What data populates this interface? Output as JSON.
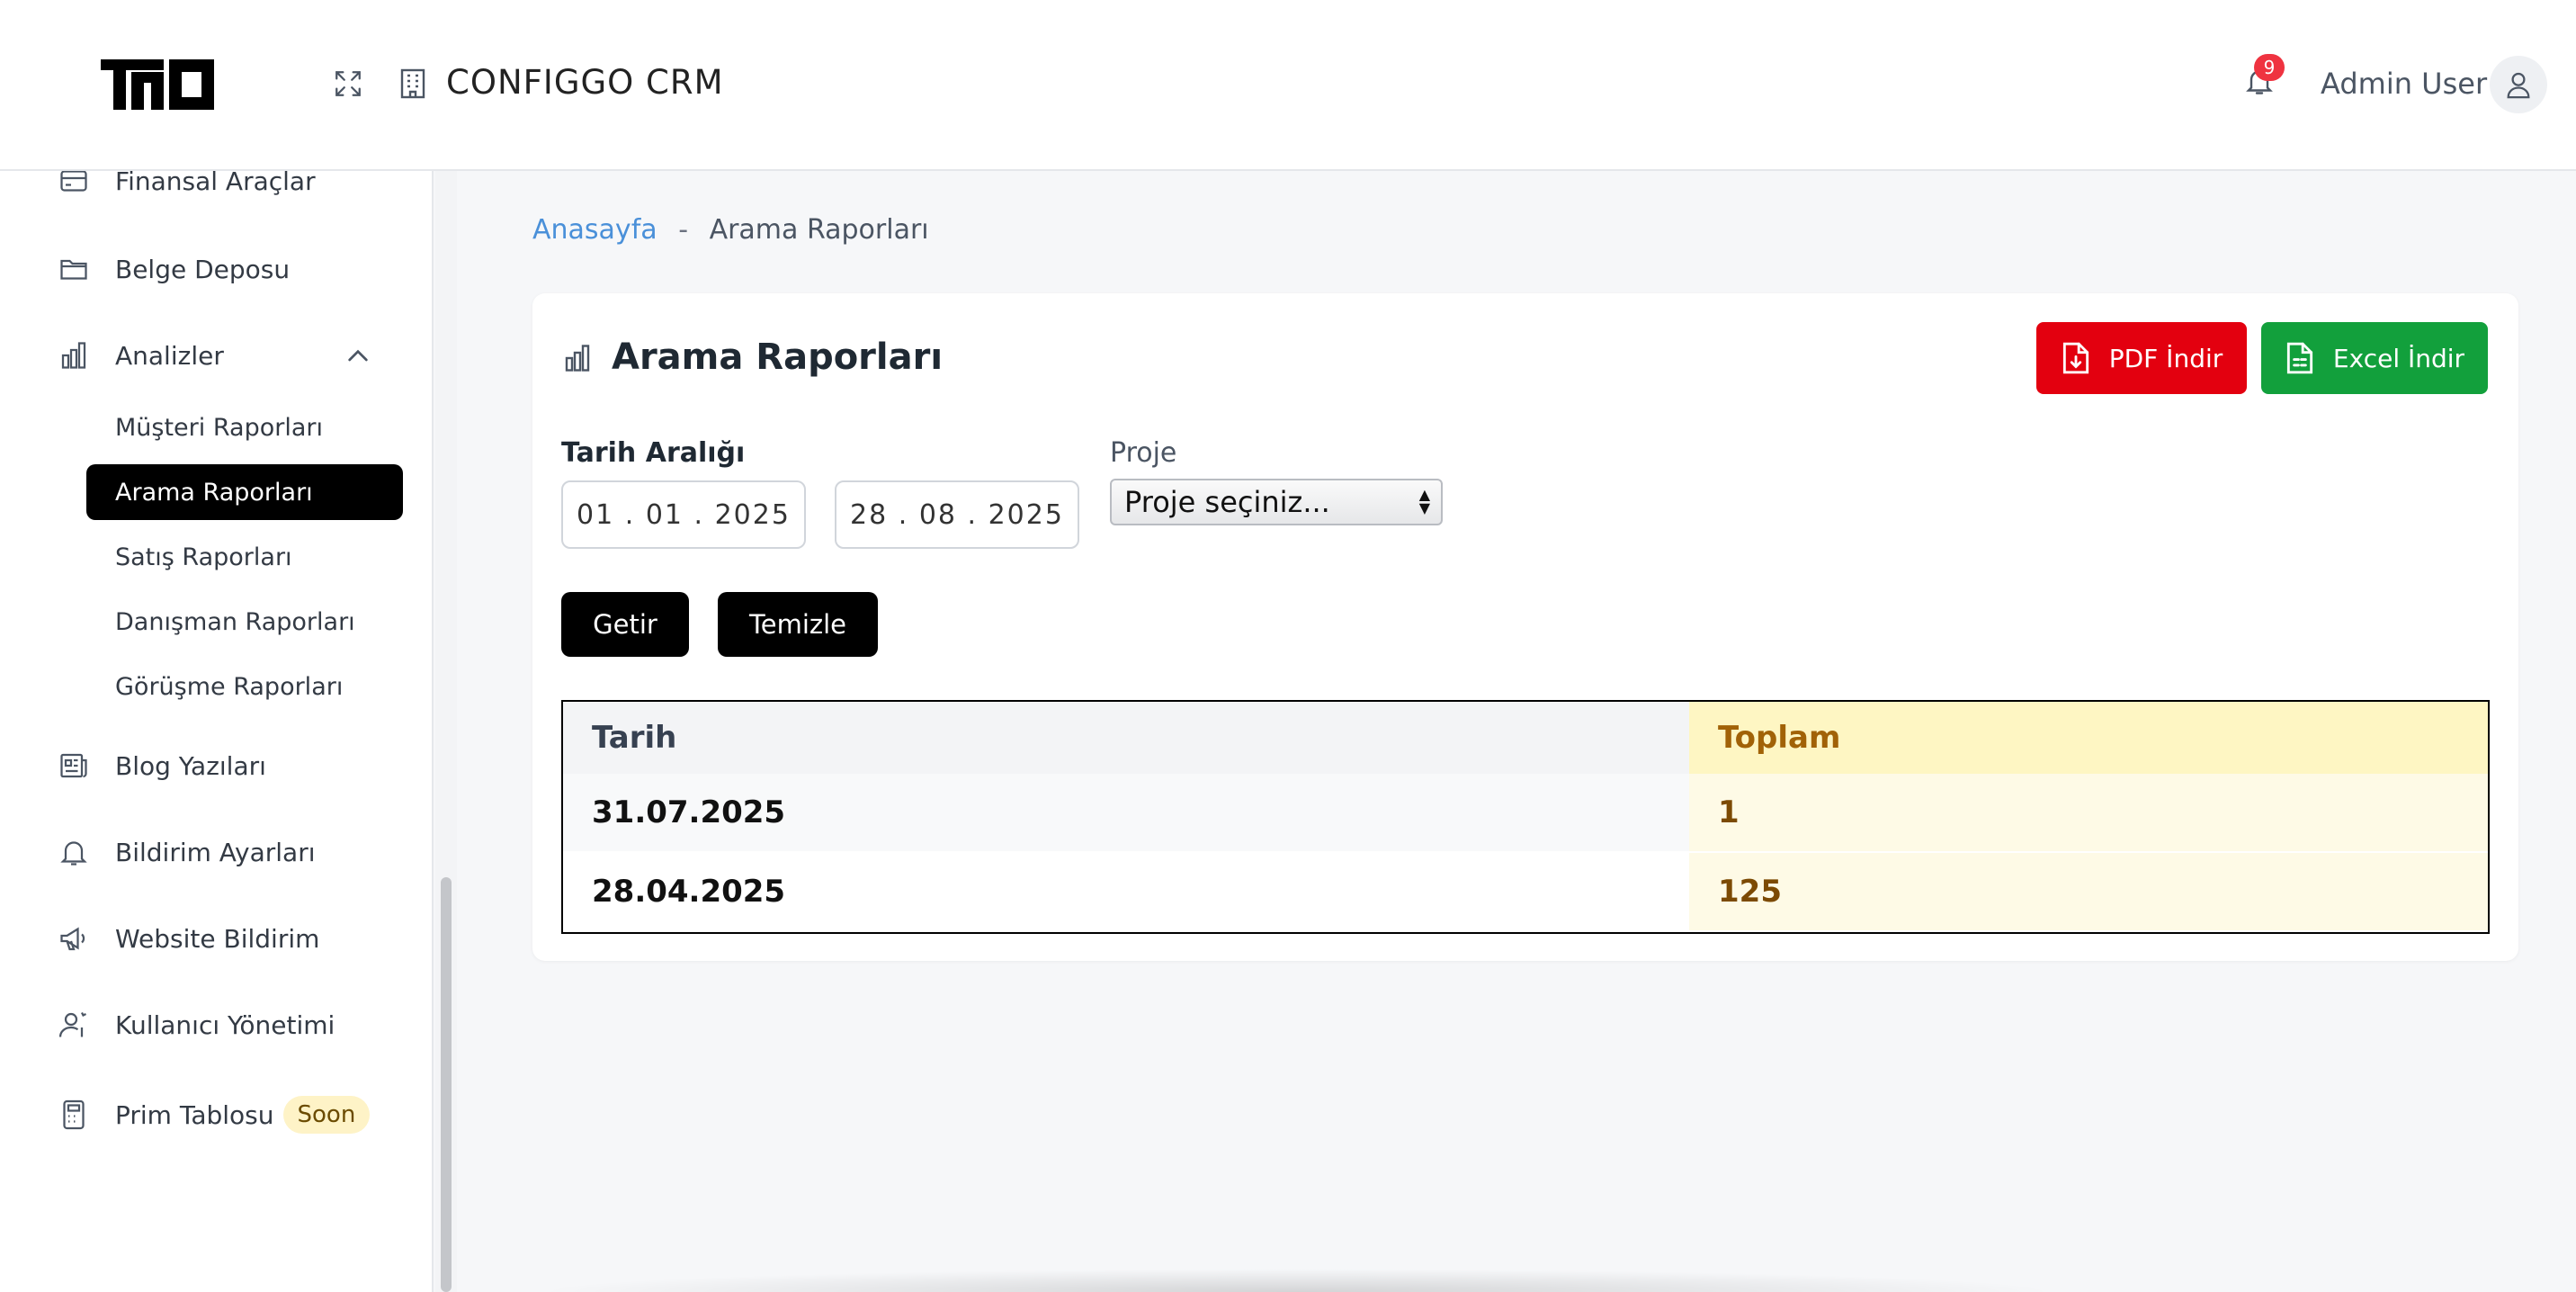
{
  "header": {
    "app_title": "CONFIGGO  CRM",
    "notification_count": "9",
    "user_name": "Admin User",
    "icons": {
      "expand": "expand-icon",
      "building": "building-icon",
      "bell": "bell-icon",
      "user": "user-icon"
    }
  },
  "sidebar": {
    "items": [
      {
        "label": "Finansal Araçlar",
        "icon": "credit-card-icon"
      },
      {
        "label": "Belge Deposu",
        "icon": "folder-icon"
      },
      {
        "label": "Analizler",
        "icon": "bar-chart-icon",
        "expanded": true
      },
      {
        "label": "Blog Yazıları",
        "icon": "newspaper-icon"
      },
      {
        "label": "Bildirim Ayarları",
        "icon": "bell-icon"
      },
      {
        "label": "Website Bildirim",
        "icon": "megaphone-icon"
      },
      {
        "label": "Kullanıcı Yönetimi",
        "icon": "user-cog-icon"
      },
      {
        "label": "Prim Tablosu",
        "icon": "calculator-icon",
        "badge": "Soon"
      }
    ],
    "analiz_subitems": [
      {
        "label": "Müşteri Raporları"
      },
      {
        "label": "Arama Raporları",
        "active": true
      },
      {
        "label": "Satış Raporları"
      },
      {
        "label": "Danışman Raporları"
      },
      {
        "label": "Görüşme Raporları"
      }
    ]
  },
  "breadcrumb": {
    "home": "Anasayfa",
    "separator": "-",
    "current": "Arama Raporları"
  },
  "report": {
    "title": "Arama Raporları",
    "pdf_button": "PDF İndir",
    "excel_button": "Excel İndir",
    "date_range_label": "Tarih Aralığı",
    "date_from": "01 . 01 . 2025",
    "date_to": "28 . 08 . 2025",
    "project_label": "Proje",
    "project_selected": "Proje seçiniz...",
    "fetch_button": "Getir",
    "clear_button": "Temizle",
    "colors": {
      "pdf": "#e3000f",
      "excel": "#12a03c",
      "link": "#4a90d9"
    }
  },
  "table": {
    "headers": [
      "Tarih",
      "Toplam"
    ],
    "rows": [
      [
        "31.07.2025",
        "1"
      ],
      [
        "28.04.2025",
        "125"
      ]
    ]
  }
}
